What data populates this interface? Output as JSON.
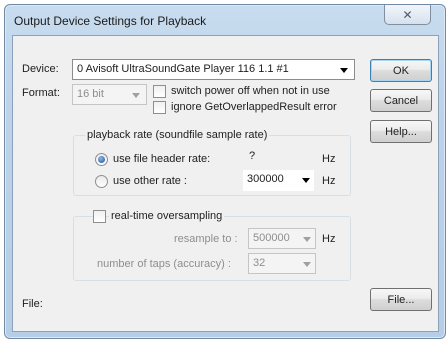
{
  "window": {
    "title": "Output Device Settings for Playback",
    "close_glyph": "✕"
  },
  "device": {
    "label": "Device:",
    "selected": "0 Avisoft UltraSoundGate Player 116 1.1 #1"
  },
  "format": {
    "label": "Format:",
    "selected": "16 bit",
    "switch_power_label": "switch power off when not in use",
    "switch_power_checked": false,
    "ignore_overlapped_label": "ignore GetOverlappedResult error",
    "ignore_overlapped_checked": false
  },
  "playback_rate": {
    "group_title": "playback rate (soundfile sample rate)",
    "use_header_label": "use file header rate:",
    "use_header_selected": true,
    "header_rate_value": "?",
    "header_rate_unit": "Hz",
    "use_other_label": "use other rate :",
    "use_other_selected": false,
    "other_rate_value": "300000",
    "other_rate_unit": "Hz"
  },
  "oversampling": {
    "group_title": "real-time oversampling",
    "enabled": false,
    "resample_label": "resample to :",
    "resample_value": "500000",
    "resample_unit": "Hz",
    "taps_label": "number of taps (accuracy) :",
    "taps_value": "32"
  },
  "file": {
    "label": "File:"
  },
  "buttons": {
    "ok": "OK",
    "cancel": "Cancel",
    "help": "Help...",
    "file": "File..."
  }
}
